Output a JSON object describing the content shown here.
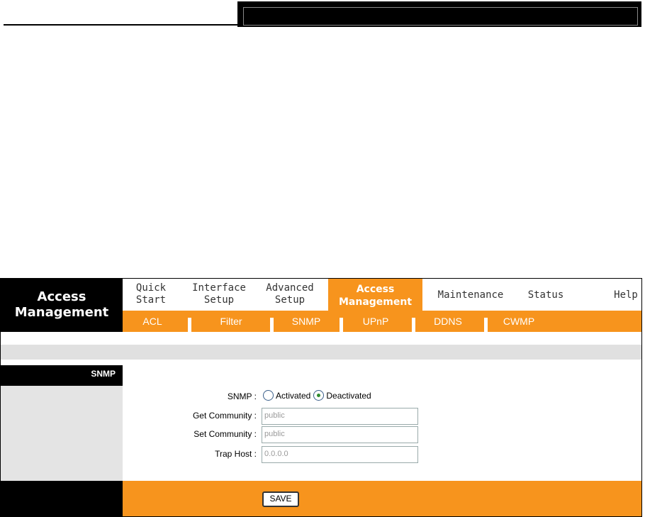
{
  "brand": {
    "line1": "Access",
    "line2": "Management"
  },
  "nav": {
    "quick_start": [
      "Quick",
      "Start"
    ],
    "interface_setup": [
      "Interface",
      "Setup"
    ],
    "advanced_setup": [
      "Advanced",
      "Setup"
    ],
    "access_management": [
      "Access",
      "Management"
    ],
    "maintenance": "Maintenance",
    "status": "Status",
    "help": "Help"
  },
  "subnav": [
    "ACL",
    "Filter",
    "SNMP",
    "UPnP",
    "DDNS",
    "CWMP"
  ],
  "section": {
    "title": "SNMP"
  },
  "form": {
    "snmp_label": "SNMP :",
    "activated": "Activated",
    "deactivated": "Deactivated",
    "selected": "Deactivated",
    "get_community_label": "Get Community :",
    "get_community_value": "public",
    "set_community_label": "Set Community :",
    "set_community_value": "public",
    "trap_host_label": "Trap Host :",
    "trap_host_value": "0.0.0.0"
  },
  "buttons": {
    "save": "SAVE"
  },
  "colors": {
    "accent": "#f7941d",
    "dark": "#000000",
    "grey": "#e4e4e4"
  }
}
